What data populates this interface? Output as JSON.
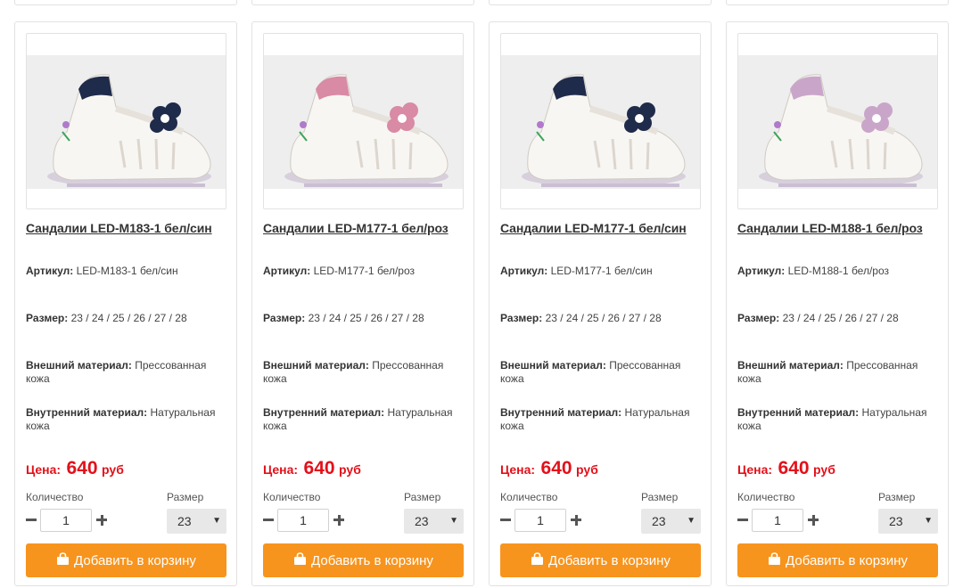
{
  "products": [
    {
      "title": "Сандалии LED-M183-1 бел/син",
      "sku_label": "Артикул:",
      "sku": "LED-M183-1 бел/син",
      "size_label": "Размер:",
      "sizes": "23 / 24 / 25 / 26 / 27 / 28",
      "outer_label": "Внешний материал:",
      "outer": "Прессованная кожа",
      "inner_label": "Внутренний материал:",
      "inner": "Натуральная кожа",
      "price_label": "Цена:",
      "price": "640",
      "currency": "руб",
      "qty_label": "Количество",
      "qty": "1",
      "size_select_label": "Размер",
      "size_selected": "23",
      "cart_label": "Добавить в корзину",
      "accent_color": "#1f2b4a"
    },
    {
      "title": "Сандалии LED-M177-1 бел/роз",
      "sku_label": "Артикул:",
      "sku": "LED-M177-1 бел/роз",
      "size_label": "Размер:",
      "sizes": "23 / 24 / 25 / 26 / 27 / 28",
      "outer_label": "Внешний материал:",
      "outer": "Прессованная кожа",
      "inner_label": "Внутренний материал:",
      "inner": "Натуральная кожа",
      "price_label": "Цена:",
      "price": "640",
      "currency": "руб",
      "qty_label": "Количество",
      "qty": "1",
      "size_select_label": "Размер",
      "size_selected": "23",
      "cart_label": "Добавить в корзину",
      "accent_color": "#d98aa4"
    },
    {
      "title": "Сандалии LED-M177-1 бел/син",
      "sku_label": "Артикул:",
      "sku": "LED-M177-1 бел/син",
      "size_label": "Размер:",
      "sizes": "23 / 24 / 25 / 26 / 27 / 28",
      "outer_label": "Внешний материал:",
      "outer": "Прессованная кожа",
      "inner_label": "Внутренний материал:",
      "inner": "Натуральная кожа",
      "price_label": "Цена:",
      "price": "640",
      "currency": "руб",
      "qty_label": "Количество",
      "qty": "1",
      "size_select_label": "Размер",
      "size_selected": "23",
      "cart_label": "Добавить в корзину",
      "accent_color": "#1f2b4a"
    },
    {
      "title": "Сандалии LED-M188-1 бел/роз",
      "sku_label": "Артикул:",
      "sku": "LED-M188-1 бел/роз",
      "size_label": "Размер:",
      "sizes": "23 / 24 / 25 / 26 / 27 / 28",
      "outer_label": "Внешний материал:",
      "outer": "Прессованная кожа",
      "inner_label": "Внутренний материал:",
      "inner": "Натуральная кожа",
      "price_label": "Цена:",
      "price": "640",
      "currency": "руб",
      "qty_label": "Количество",
      "qty": "1",
      "size_select_label": "Размер",
      "size_selected": "23",
      "cart_label": "Добавить в корзину",
      "accent_color": "#c9a6c9"
    }
  ],
  "icons": {
    "minus": "minus-icon",
    "plus": "plus-icon",
    "caret": "chevron-down-icon",
    "cart": "shopping-bag-icon"
  },
  "colors": {
    "price": "#e3101a",
    "button": "#f7941d",
    "select_bg": "#e8e8e8",
    "border": "#e2e2e2"
  }
}
